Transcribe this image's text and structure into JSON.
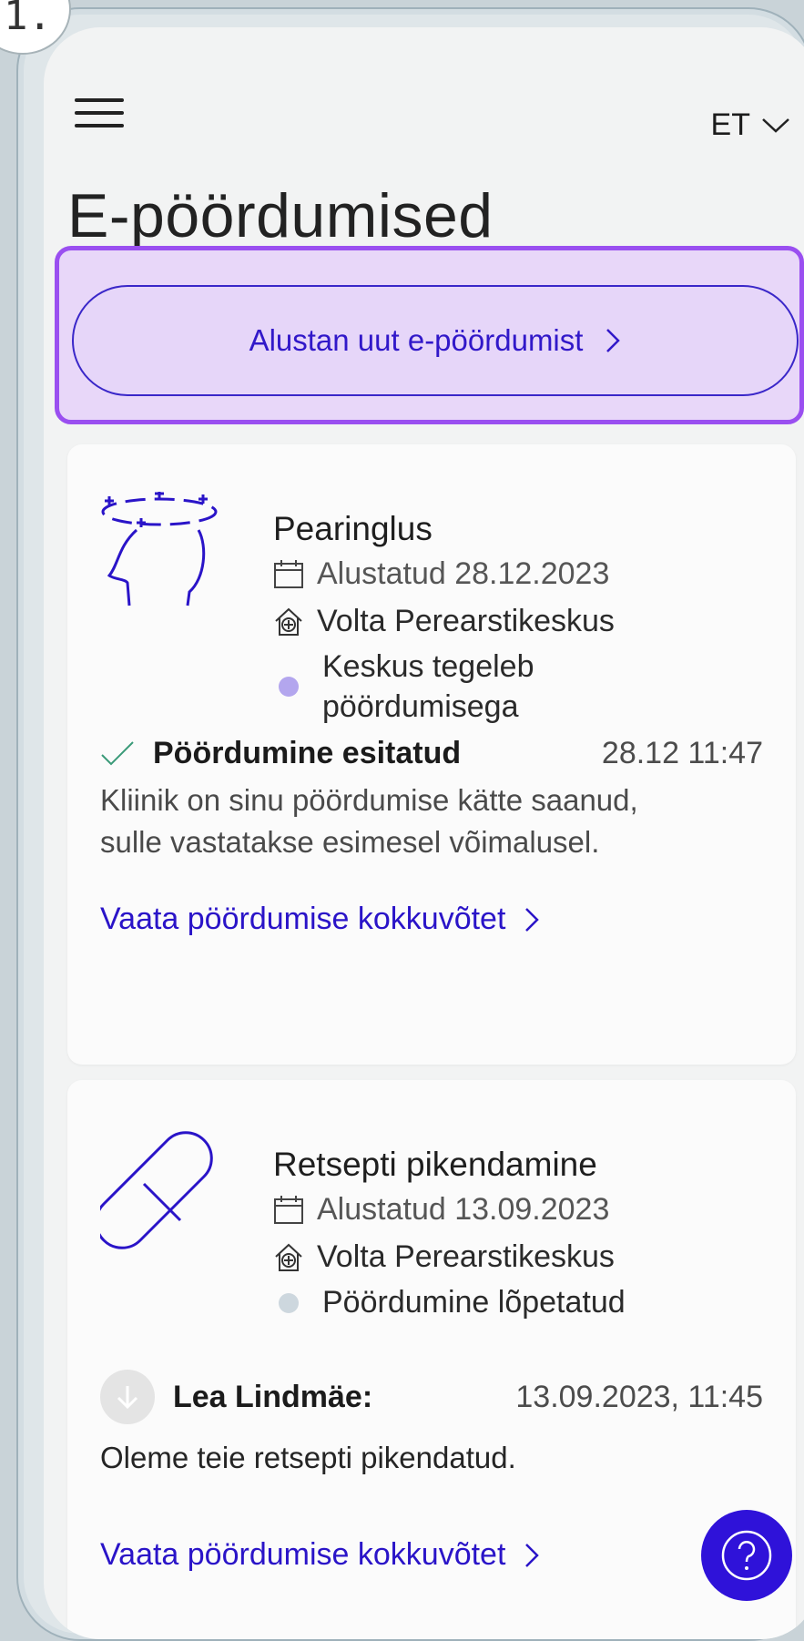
{
  "step_badge": "1.",
  "header": {
    "lang": "ET"
  },
  "page_title": "E-pöördumised",
  "cta": {
    "label": "Alustan uut e-pöördumist"
  },
  "cards": [
    {
      "title": "Pearinglus",
      "icon": "dizziness-head-icon",
      "started": "Alustatud 28.12.2023",
      "clinic": "Volta Perearstikeskus",
      "status_line1": "Keskus tegeleb",
      "status_line2": "pöördumisega",
      "status_color": "#b3a6ee",
      "event_title": "Pöördumine esitatud",
      "event_time": "28.12 11:47",
      "event_text_1": "Kliinik on sinu pöördumise kätte saanud,",
      "event_text_2": "sulle vastatakse esimesel võimalusel.",
      "link": "Vaata pöördumise kokkuvõtet"
    },
    {
      "title": "Retsepti pikendamine",
      "icon": "pill-capsule-icon",
      "started": "Alustatud 13.09.2023",
      "clinic": "Volta Perearstikeskus",
      "status": "Pöördumine lõpetatud",
      "status_color": "#cdd7de",
      "event_author": "Lea Lindmäe:",
      "event_time": "13.09.2023, 11:45",
      "event_text": "Oleme teie retsepti pikendatud.",
      "link": "Vaata pöördumise kokkuvõtet"
    }
  ],
  "colors": {
    "accent": "#2f12d9",
    "highlight": "#9a4ff0"
  }
}
